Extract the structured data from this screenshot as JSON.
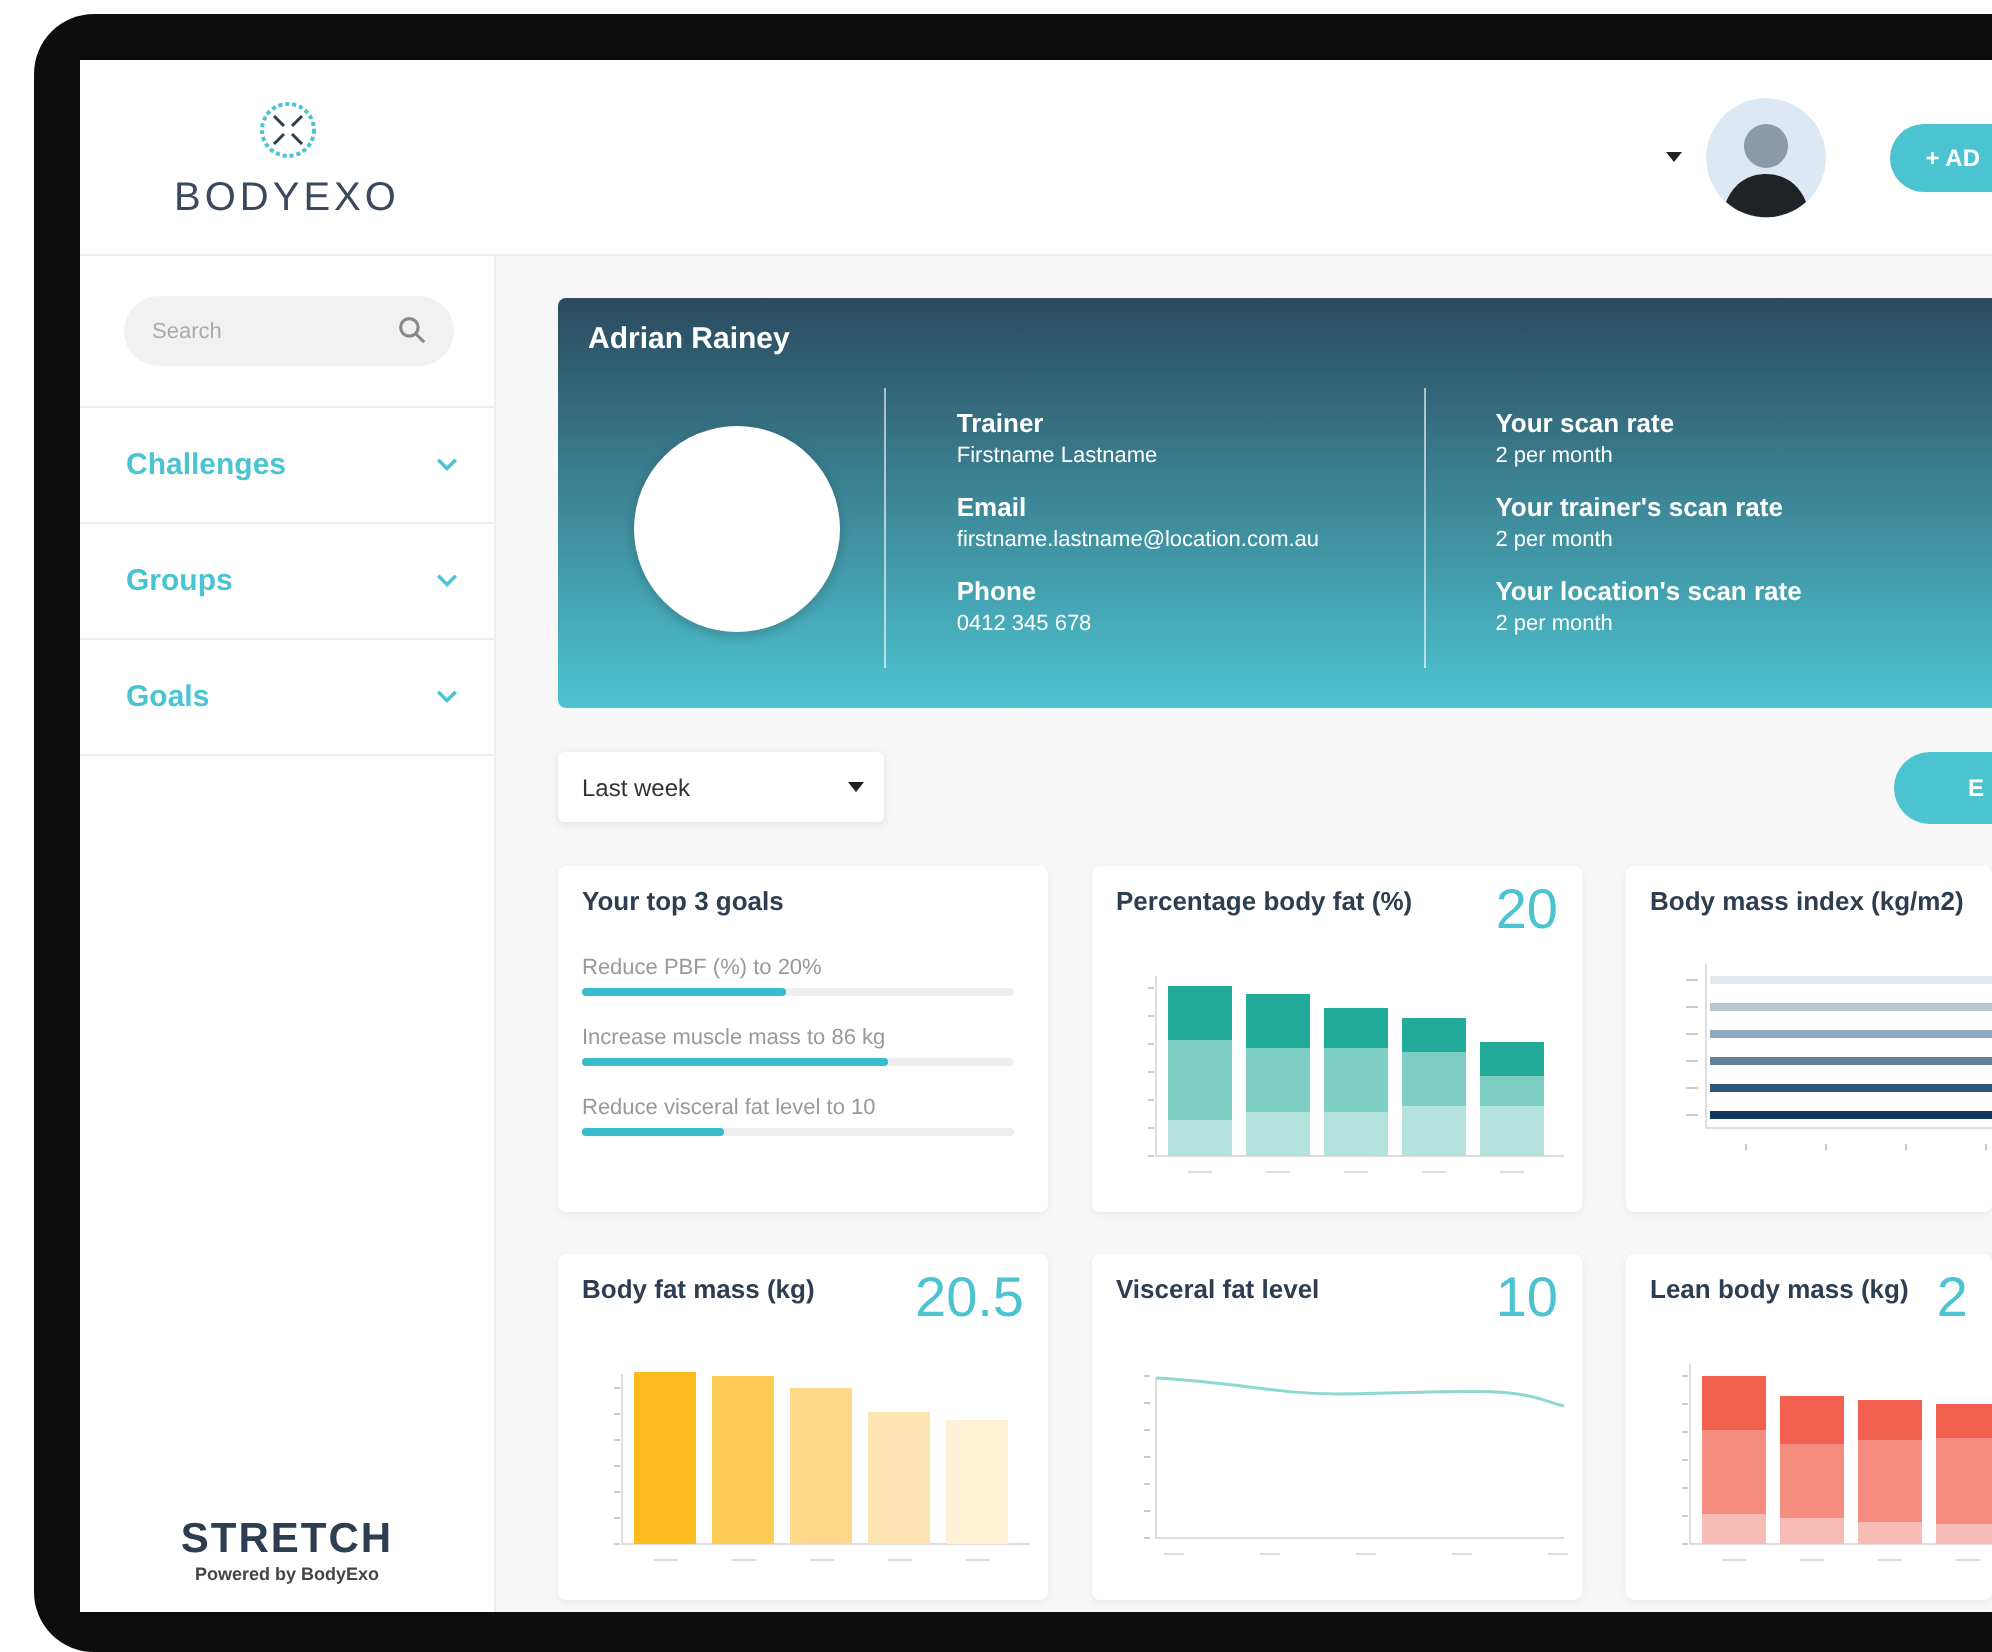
{
  "brand": {
    "name": "BODYEXO"
  },
  "header": {
    "add_button": "+ AD"
  },
  "sidebar": {
    "search": {
      "placeholder": "Search"
    },
    "items": [
      {
        "label": "Challenges"
      },
      {
        "label": "Groups"
      },
      {
        "label": "Goals"
      }
    ],
    "footer": {
      "name": "STRETCH",
      "tagline": "Powered by BodyExo"
    }
  },
  "profile": {
    "name": "Adrian Rainey",
    "details": [
      {
        "label": "Trainer",
        "value": "Firstname Lastname"
      },
      {
        "label": "Email",
        "value": "firstname.lastname@location.com.au"
      },
      {
        "label": "Phone",
        "value": "0412 345 678"
      }
    ],
    "rates": [
      {
        "label": "Your scan rate",
        "value": "2 per month"
      },
      {
        "label": "Your trainer's scan rate",
        "value": "2 per month"
      },
      {
        "label": "Your location's scan rate",
        "value": "2 per month"
      }
    ]
  },
  "period_select": {
    "value": "Last week"
  },
  "right_button": "E",
  "goals_card": {
    "title": "Your top 3 goals",
    "goals": [
      {
        "label": "Reduce PBF (%) to 20%",
        "level": 0.47
      },
      {
        "label": "Increase muscle mass to 86 kg",
        "level": 0.71
      },
      {
        "label": "Reduce visceral fat level to 10",
        "level": 0.33
      }
    ]
  },
  "metric_cards": [
    {
      "title": "Percentage body fat (%)",
      "value": "20",
      "kind": "stacked-teal"
    },
    {
      "title": "Body mass index (kg/m2)",
      "kind": "hbars"
    },
    {
      "title": "Body fat mass (kg)",
      "value": "20.5",
      "kind": "bars"
    },
    {
      "title": "Visceral fat level",
      "value": "10",
      "kind": "line"
    },
    {
      "title": "Lean body mass (kg)",
      "value": "2",
      "kind": "stacked-red"
    }
  ]
}
